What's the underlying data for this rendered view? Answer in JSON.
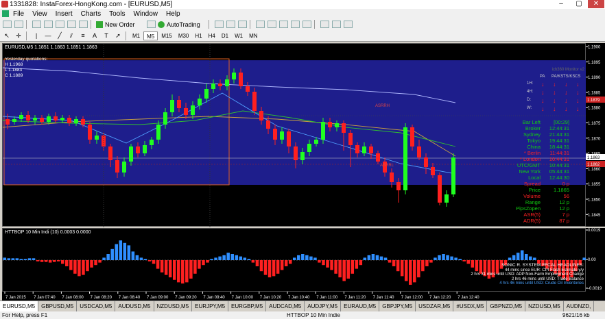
{
  "window": {
    "title": "1331828: InstaForex-HongKong.com - [EURUSD,M5]"
  },
  "menu": [
    "File",
    "View",
    "Insert",
    "Charts",
    "Tools",
    "Window",
    "Help"
  ],
  "toolbar": {
    "new_order": "New Order",
    "autotrading": "AutoTrading"
  },
  "timeframes": [
    "M1",
    "M5",
    "M15",
    "M30",
    "H1",
    "H4",
    "D1",
    "W1",
    "MN"
  ],
  "active_timeframe": "M5",
  "chart": {
    "header": "EURUSD,M5  1.1851 1.1863 1.1851 1.1863",
    "yesterday": {
      "label": "Yesterday quotations:",
      "h": "H 1.1968",
      "l": "L 1.1883",
      "c": "C 1.1889"
    },
    "price_ticks": [
      "1.1900",
      "1.1895",
      "1.1890",
      "1.1885",
      "1.1880",
      "1.1875",
      "1.1870",
      "1.1865",
      "1.1860",
      "1.1855",
      "1.1850",
      "1.1845"
    ],
    "current_price": "1.1863",
    "marker_price": "1.1879",
    "marker2_price": "1.1862",
    "line_label_1": "ASRRH",
    "line_label_2": "ASRRL"
  },
  "monitor": {
    "title": "ich360 Monitor v2",
    "cols": [
      "PA",
      "PA/KS",
      "TS/KS",
      "CS"
    ],
    "rows": [
      "1H:",
      "4H:",
      "D:",
      "W:"
    ]
  },
  "info_panel": [
    {
      "label": "Bar Left",
      "value": "[00:29]",
      "color": "#1c1"
    },
    {
      "label": "Broker",
      "value": "12:44:31",
      "color": "#1c1"
    },
    {
      "label": "Sydney",
      "value": "21:44:31",
      "color": "#1c1"
    },
    {
      "label": "Tokyo",
      "value": "19:44:31",
      "color": "#1c1"
    },
    {
      "label": "China",
      "value": "18:44:31",
      "color": "#1c1"
    },
    {
      "label": "* Berlin",
      "value": "11:44:31",
      "color": "#f22"
    },
    {
      "label": "* London",
      "value": "10:44:31",
      "color": "#f22"
    },
    {
      "label": "UTC/GMT",
      "value": "10:44:31",
      "color": "#1c1"
    },
    {
      "label": "New York",
      "value": "05:44:31",
      "color": "#1c1"
    },
    {
      "label": "Local",
      "value": "12:44:30",
      "color": "#1c1"
    },
    {
      "label": "Spread",
      "value": "0 p",
      "color": "#f22"
    },
    {
      "label": "Price",
      "value": "1.1865",
      "color": "#1c1"
    },
    {
      "label": "Volume",
      "value": "56",
      "color": "#f22"
    },
    {
      "label": "Range",
      "value": "12 p",
      "color": "#1c1"
    },
    {
      "label": "PipsZopen",
      "value": "12 p",
      "color": "#1c1"
    },
    {
      "label": "ASR(5)",
      "value": "7 p",
      "color": "#f22"
    },
    {
      "label": "ADR(5)",
      "value": "87 p",
      "color": "#f22"
    }
  ],
  "indicator": {
    "header": "HTTBOP 10 Min Indi (10) 0.0003 0.0000",
    "ticks": [
      "0.0019",
      "0.00",
      "-0.0019"
    ]
  },
  "news": {
    "title": "SONIC R. SYSTEM  FFCAL HEADLINES:",
    "lines": [
      {
        "text": "44 mins since EUR: CPI Flash Estimate y/y",
        "color": "#fff"
      },
      {
        "text": "2 hrs 31 mins until USD: ADP Non-Farm Employment Change",
        "color": "#fff"
      },
      {
        "text": "2 hrs 46 mins until USD: Trade Balance",
        "color": "#fff"
      },
      {
        "text": "4 hrs 46 mins until USD: Crude Oil Inventories",
        "color": "#4aa3ff"
      }
    ]
  },
  "time_labels": [
    "7 Jan 2015",
    "7 Jan 07:40",
    "7 Jan 08:00",
    "7 Jan 08:20",
    "7 Jan 08:40",
    "7 Jan 09:00",
    "7 Jan 09:20",
    "7 Jan 09:40",
    "7 Jan 10:00",
    "7 Jan 10:20",
    "7 Jan 10:40",
    "7 Jan 11:00",
    "7 Jan 11:20",
    "7 Jan 11:40",
    "7 Jan 12:00",
    "7 Jan 12:20",
    "7 Jan 12:40"
  ],
  "tabs": [
    "EURUSD,M5",
    "GBPUSD,M5",
    "USDCAD,M5",
    "AUDUSD,M5",
    "NZDUSD,M5",
    "EURJPY,M5",
    "EURGBP,M5",
    "AUDCAD,M5",
    "AUDJPY,M5",
    "EURAUD,M5",
    "GBPJPY,M5",
    "USDZAR,M5",
    "#USDX,M5",
    "GBPNZD,M5",
    "NZDUSD,M5",
    "AUDNZD,"
  ],
  "status": {
    "help": "For Help, press F1",
    "middle": "HTTBOP 10 Min Indie",
    "right": "9621/16 kb"
  }
}
